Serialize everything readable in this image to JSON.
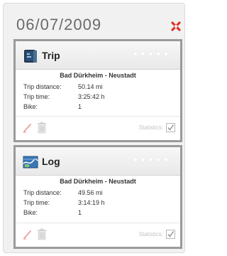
{
  "header": {
    "date": "06/07/2009"
  },
  "cards": [
    {
      "title": "Trip",
      "icon": "trip-book-icon",
      "rating": "★★★★★",
      "route": "Bad Dürkheim - Neustadt",
      "rows": [
        {
          "label": "Trip distance:",
          "value": "50.14 mi"
        },
        {
          "label": "Trip time:",
          "value": "3:25:42 h"
        },
        {
          "label": "Bike:",
          "value": "1"
        }
      ],
      "statistics_label": "Statistics:",
      "statistics_checked": true
    },
    {
      "title": "Log",
      "icon": "log-map-icon",
      "rating": "★★★★★",
      "route": "Bad Dürkheim - Neustadt",
      "rows": [
        {
          "label": "Trip distance:",
          "value": "49.56 mi"
        },
        {
          "label": "Trip time:",
          "value": "3:14:19 h"
        },
        {
          "label": "Bike:",
          "value": "1"
        }
      ],
      "statistics_label": "Statistics:",
      "statistics_checked": true
    }
  ],
  "colors": {
    "close": "#d9342b",
    "card_border": "#9a9a9a",
    "edit": "#e8a5a5"
  }
}
